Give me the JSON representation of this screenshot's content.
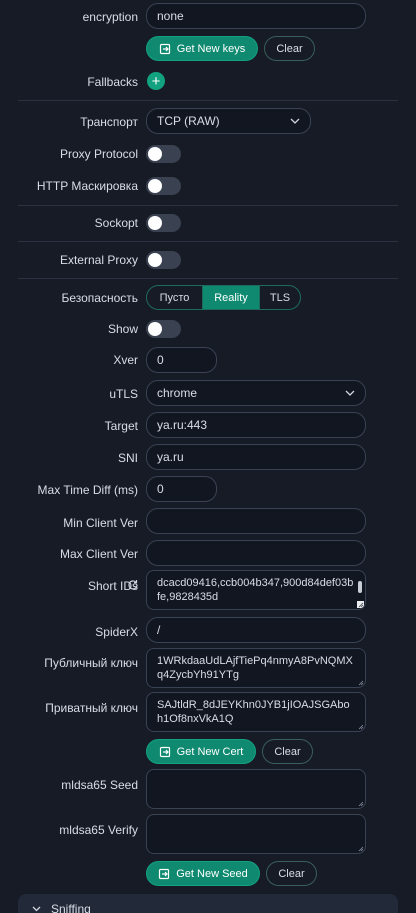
{
  "encryption": {
    "label": "encryption",
    "value": "none"
  },
  "keys_buttons": {
    "get_new_keys": "Get New keys",
    "clear": "Clear"
  },
  "fallbacks": {
    "label": "Fallbacks"
  },
  "transport": {
    "label": "Транспорт",
    "value": "TCP (RAW)"
  },
  "proxy_protocol": {
    "label": "Proxy Protocol"
  },
  "http_masking": {
    "label": "HTTP Маскировка"
  },
  "sockopt": {
    "label": "Sockopt"
  },
  "external_proxy": {
    "label": "External Proxy"
  },
  "security": {
    "label": "Безопасность",
    "options": [
      "Пусто",
      "Reality",
      "TLS"
    ],
    "selected": "Reality"
  },
  "show": {
    "label": "Show"
  },
  "xver": {
    "label": "Xver",
    "value": "0"
  },
  "utls": {
    "label": "uTLS",
    "value": "chrome"
  },
  "target": {
    "label": "Target",
    "value": "ya.ru:443"
  },
  "sni": {
    "label": "SNI",
    "value": "ya.ru"
  },
  "max_time_diff": {
    "label": "Max Time Diff (ms)",
    "value": "0"
  },
  "min_client_ver": {
    "label": "Min Client Ver",
    "value": ""
  },
  "max_client_ver": {
    "label": "Max Client Ver",
    "value": ""
  },
  "short_ids": {
    "label": "Short IDs",
    "value": "dcacd09416,ccb004b347,900d84def03bfe,9828435d"
  },
  "spiderx": {
    "label": "SpiderX",
    "value": "/"
  },
  "public_key": {
    "label": "Публичный ключ",
    "value": "1WRkdaaUdLAjfTiePq4nmyA8PvNQMXq4ZycbYh91YTg"
  },
  "private_key": {
    "label": "Приватный ключ",
    "value": "SAJtldR_8dJEYKhn0JYB1jIOAJSGAboh1Of8nxVkA1Q"
  },
  "cert_buttons": {
    "get_new_cert": "Get New Cert",
    "clear": "Clear"
  },
  "mldsa65_seed": {
    "label": "mldsa65 Seed",
    "value": ""
  },
  "mldsa65_verify": {
    "label": "mldsa65 Verify",
    "value": ""
  },
  "seed_buttons": {
    "get_new_seed": "Get New Seed",
    "clear": "Clear"
  },
  "sniffing": {
    "label": "Sniffing"
  },
  "colors": {
    "background": "#161b26",
    "accent": "#0f8a70",
    "input_bg": "#111621",
    "border": "#3a4354"
  }
}
